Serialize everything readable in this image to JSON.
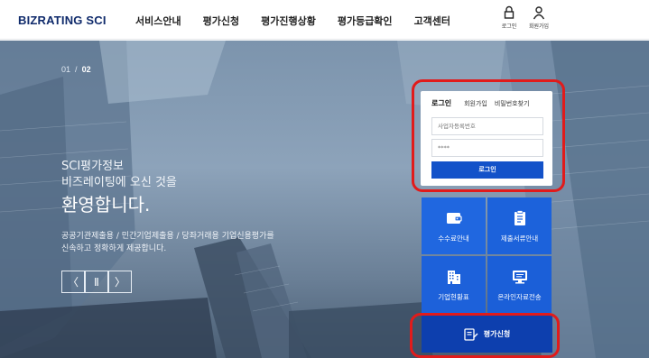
{
  "header": {
    "logo": "BIZRATING SCI",
    "nav": [
      "서비스안내",
      "평가신청",
      "평가진행상황",
      "평가등급확인",
      "고객센터"
    ],
    "util": {
      "login": "로그인",
      "join": "회원가입"
    }
  },
  "hero": {
    "pager_current": "01",
    "pager_sep": "/",
    "pager_total": "02",
    "line1": "SCI평가정보",
    "line2": "비즈레이팅에 오신 것을",
    "line3": "환영합니다.",
    "desc1": "공공기관제출용 / 민간기업제출용 / 당좌거래용 기업신용평가를",
    "desc2": "신속하고 정확하게 제공합니다.",
    "controls": {
      "prev": "〈",
      "pause": "Ⅱ",
      "next": "〉"
    }
  },
  "login_panel": {
    "tab_active": "로그인",
    "link_join": "회원가입",
    "link_find_pw": "비밀번호찾기",
    "id_placeholder": "사업자등록번호",
    "pw_placeholder": "****",
    "submit": "로그인"
  },
  "tiles": [
    {
      "label": "수수료안내",
      "icon": "wallet-icon"
    },
    {
      "label": "제출서류안내",
      "icon": "clipboard-icon"
    },
    {
      "label": "기업현황표",
      "icon": "building-icon"
    },
    {
      "label": "온라인자료전송",
      "icon": "monitor-icon"
    }
  ],
  "apply": {
    "label": "평가신청",
    "icon": "application-form-icon"
  },
  "colors": {
    "brand": "#0f2a6b",
    "primary": "#1352c9",
    "tile": "#1a5ad6",
    "apply": "#0d3fae",
    "highlight": "#e11b1b"
  }
}
